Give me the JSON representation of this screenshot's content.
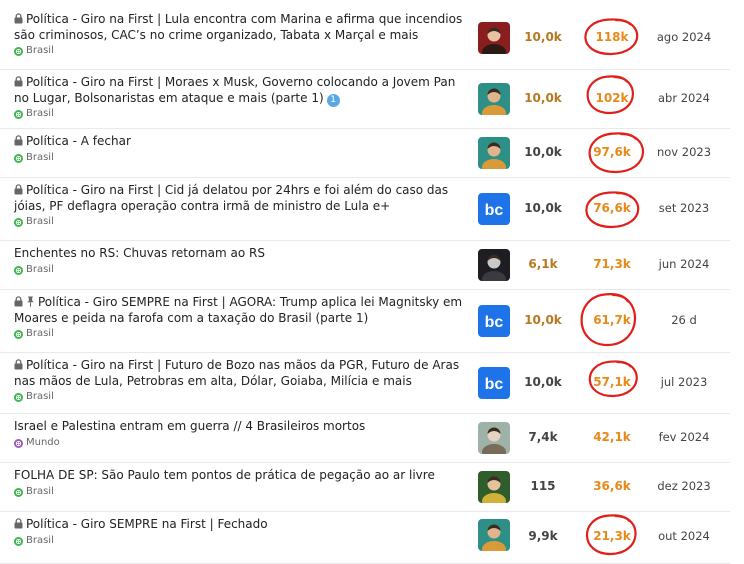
{
  "topics": [
    {
      "locked": true,
      "pinned": false,
      "title": "Política - Giro na First | Lula encontra com Marina e afirma que incendios são criminosos, CAC’s no crime organizado, Tabata x Marçal e mais",
      "category": "Brasil",
      "category_color": "#3db34a",
      "avatar": "avatar-person-dark",
      "replies": "10,0k",
      "replies_color": "#b7791f",
      "views": "118k",
      "views_circled": true,
      "date": "ago 2024"
    },
    {
      "locked": true,
      "pinned": false,
      "title": "Política - Giro na First | Moraes x Musk, Governo colocando a Jovem Pan no Lugar, Bolsonaristas em ataque e mais (parte 1)",
      "unread_count": "1",
      "category": "Brasil",
      "category_color": "#3db34a",
      "avatar": "avatar-person-teal",
      "replies": "10,0k",
      "replies_color": "#b7791f",
      "views": "102k",
      "views_circled": true,
      "date": "abr 2024"
    },
    {
      "locked": true,
      "pinned": false,
      "title": "Política - A fechar",
      "category": "Brasil",
      "category_color": "#3db34a",
      "avatar": "avatar-person-teal",
      "replies": "10,0k",
      "replies_color": "#444444",
      "views": "97,6k",
      "views_circled": true,
      "date": "nov 2023"
    },
    {
      "locked": true,
      "pinned": false,
      "title": "Política - Giro na First | Cid já delatou por 24hrs e foi além do caso das jóias, PF deflagra operação contra irmã de ministro de Lula e+",
      "category": "Brasil",
      "category_color": "#3db34a",
      "avatar": "avatar-bc-logo",
      "replies": "10,0k",
      "replies_color": "#444444",
      "views": "76,6k",
      "views_circled": true,
      "date": "set 2023"
    },
    {
      "locked": false,
      "pinned": false,
      "title": "Enchentes no RS: Chuvas retornam ao RS",
      "category": "Brasil",
      "category_color": "#3db34a",
      "avatar": "avatar-person-gray",
      "replies": "6,1k",
      "replies_color": "#b7791f",
      "views": "71,3k",
      "views_circled": false,
      "date": "jun 2024"
    },
    {
      "locked": true,
      "pinned": true,
      "title": "Política - Giro SEMPRE na First | AGORA: Trump aplica lei Magnitsky em Moares e peida na farofa com a taxação do Brasil (parte 1)",
      "category": "Brasil",
      "category_color": "#3db34a",
      "avatar": "avatar-bc-logo",
      "replies": "10,0k",
      "replies_color": "#b7791f",
      "views": "61,7k",
      "views_circled": true,
      "date": "26 d"
    },
    {
      "locked": true,
      "pinned": false,
      "title": "Política - Giro na First | Futuro de Bozo nas mãos da PGR, Futuro de Aras nas mãos de Lula, Petrobras em alta, Dólar, Goiaba, Milícia e mais",
      "category": "Brasil",
      "category_color": "#3db34a",
      "avatar": "avatar-bc-logo",
      "replies": "10,0k",
      "replies_color": "#444444",
      "views": "57,1k",
      "views_circled": true,
      "date": "jul 2023"
    },
    {
      "locked": false,
      "pinned": false,
      "title": "Israel e Palestina entram em guerra // 4 Brasileiros mortos",
      "category": "Mundo",
      "category_color": "#9b59b6",
      "avatar": "avatar-person-light",
      "replies": "7,4k",
      "replies_color": "#444444",
      "views": "42,1k",
      "views_circled": false,
      "date": "fev 2024"
    },
    {
      "locked": false,
      "pinned": false,
      "title": "FOLHA DE SP: São Paulo tem pontos de prática de pegação ao ar livre",
      "category": "Brasil",
      "category_color": "#3db34a",
      "avatar": "avatar-person-green",
      "replies": "115",
      "replies_color": "#444444",
      "views": "36,6k",
      "views_circled": false,
      "date": "dez 2023"
    },
    {
      "locked": true,
      "pinned": false,
      "title": "Política - Giro SEMPRE na First | Fechado",
      "category": "Brasil",
      "category_color": "#3db34a",
      "avatar": "avatar-person-teal",
      "replies": "9,9k",
      "replies_color": "#444444",
      "views": "21,3k",
      "views_circled": true,
      "date": "out 2024"
    }
  ]
}
